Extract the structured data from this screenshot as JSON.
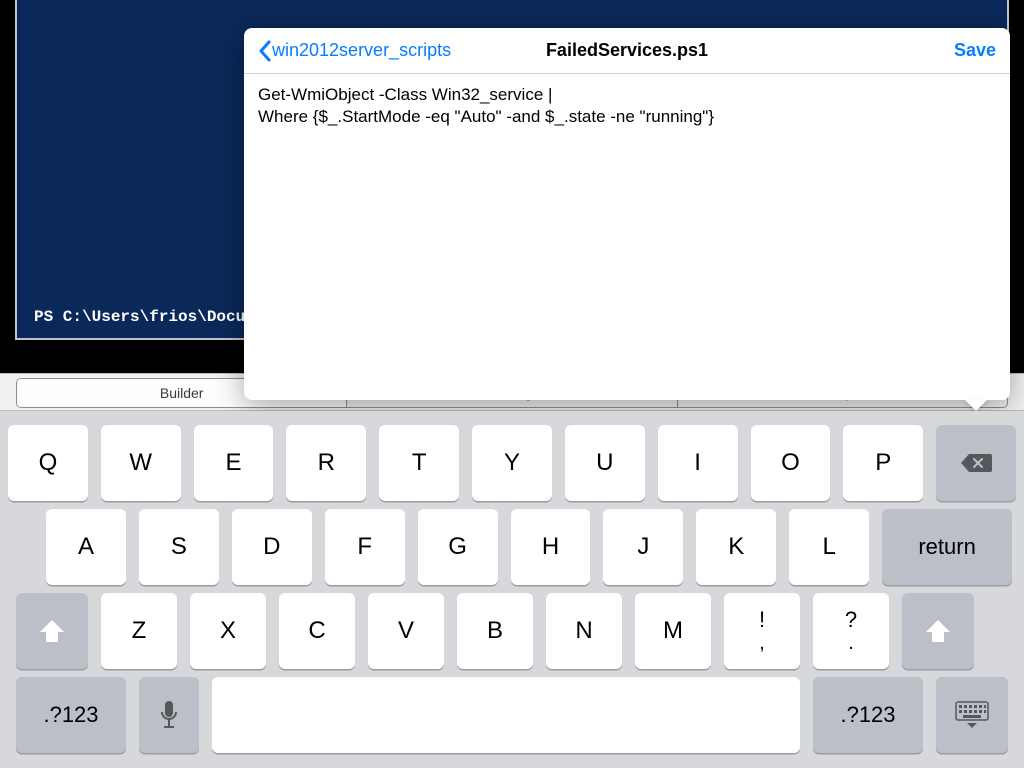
{
  "terminal": {
    "prompt": "PS C:\\Users\\frios\\Docume"
  },
  "tabs": {
    "builder": "Builder",
    "history": "History",
    "scripts": "Scripts"
  },
  "popover": {
    "back_label": "win2012server_scripts",
    "title": "FailedServices.ps1",
    "save_label": "Save",
    "code_line1": "Get-WmiObject -Class Win32_service |",
    "code_line2": "Where {$_.StartMode -eq \"Auto\" -and $_.state -ne \"running\"}"
  },
  "keyboard": {
    "row1": [
      "Q",
      "W",
      "E",
      "R",
      "T",
      "Y",
      "U",
      "I",
      "O",
      "P"
    ],
    "row2": [
      "A",
      "S",
      "D",
      "F",
      "G",
      "H",
      "J",
      "K",
      "L"
    ],
    "row3": [
      "Z",
      "X",
      "C",
      "V",
      "B",
      "N",
      "M"
    ],
    "punct1_top": "!",
    "punct1_bot": ",",
    "punct2_top": "?",
    "punct2_bot": ".",
    "return": "return",
    "numlabel": ".?123"
  }
}
